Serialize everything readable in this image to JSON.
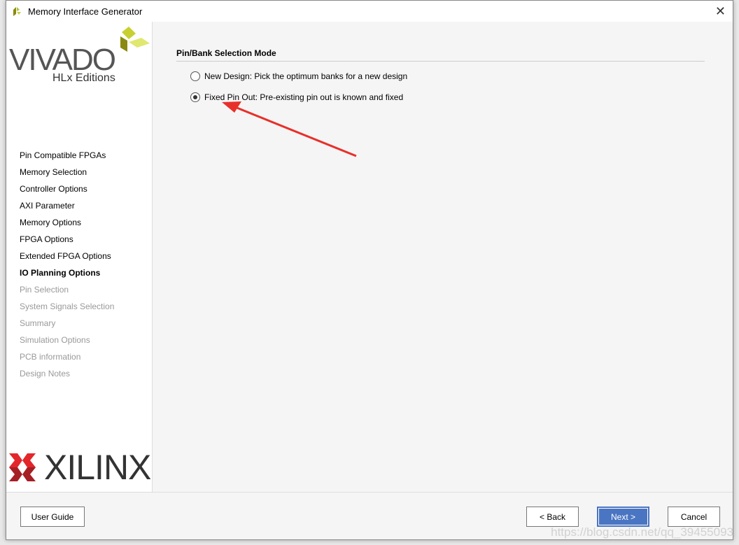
{
  "window": {
    "title": "Memory Interface Generator"
  },
  "branding": {
    "vivado": "VIVADO",
    "edition": "HLx Editions",
    "xilinx": "XILINX"
  },
  "steps": [
    {
      "label": "Pin Compatible FPGAs",
      "state": "done"
    },
    {
      "label": "Memory Selection",
      "state": "done"
    },
    {
      "label": "Controller Options",
      "state": "done"
    },
    {
      "label": "AXI Parameter",
      "state": "done"
    },
    {
      "label": "Memory Options",
      "state": "done"
    },
    {
      "label": "FPGA Options",
      "state": "done"
    },
    {
      "label": "Extended FPGA Options",
      "state": "done"
    },
    {
      "label": "IO Planning Options",
      "state": "current"
    },
    {
      "label": "Pin Selection",
      "state": "disabled"
    },
    {
      "label": "System Signals Selection",
      "state": "disabled"
    },
    {
      "label": "Summary",
      "state": "disabled"
    },
    {
      "label": "Simulation Options",
      "state": "disabled"
    },
    {
      "label": "PCB information",
      "state": "disabled"
    },
    {
      "label": "Design Notes",
      "state": "disabled"
    }
  ],
  "main": {
    "section_title": "Pin/Bank Selection Mode",
    "options": [
      {
        "label": "New Design: Pick the optimum banks for a new design",
        "selected": false
      },
      {
        "label": "Fixed Pin Out: Pre-existing pin out is known and fixed",
        "selected": true
      }
    ]
  },
  "buttons": {
    "user_guide": "User Guide",
    "back": "< Back",
    "next": "Next >",
    "cancel": "Cancel"
  },
  "watermark": "https://blog.csdn.net/qq_39455093",
  "colors": {
    "accent": "#4a75c2",
    "annotation_arrow": "#e8302a"
  }
}
